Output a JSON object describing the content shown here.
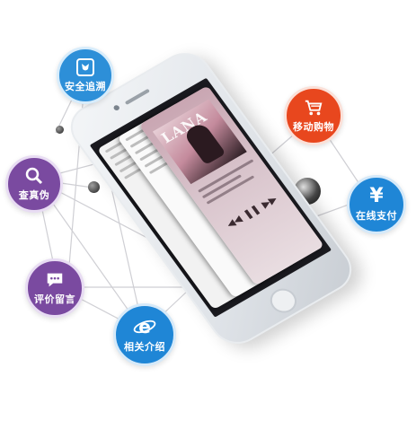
{
  "nodes": {
    "trace": {
      "label": "安全追溯",
      "icon": "shield-tulip-icon",
      "color": "#2d8fd8"
    },
    "shopping": {
      "label": "移动购物",
      "icon": "shopping-cart-icon",
      "color": "#e8471e"
    },
    "verify": {
      "label": "查真伪",
      "icon": "magnifier-icon",
      "color": "#7a4aa0"
    },
    "payment": {
      "label": "在线支付",
      "icon": "yen-icon",
      "color": "#1f86d6"
    },
    "review": {
      "label": "评价留言",
      "icon": "chat-bubble-icon",
      "color": "#7a4aa0"
    },
    "intro": {
      "label": "相关介绍",
      "icon": "internet-explorer-icon",
      "color": "#1f86d6"
    }
  },
  "phone": {
    "album_text": "LANA"
  }
}
